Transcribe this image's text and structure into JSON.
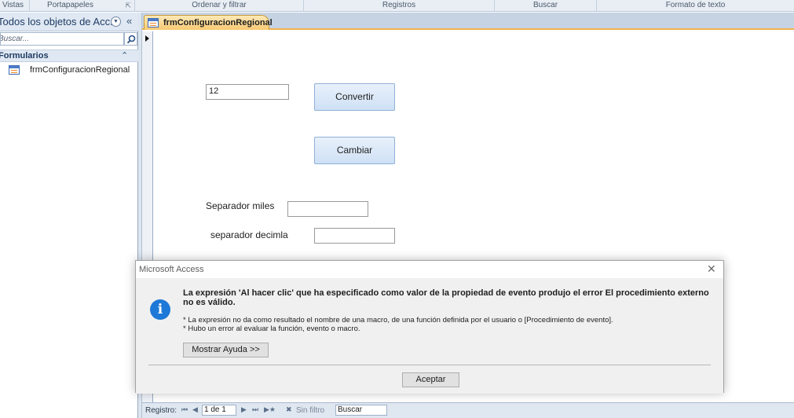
{
  "ribbon": {
    "groups": [
      "Vistas",
      "Portapapeles",
      "Ordenar y filtrar",
      "Registros",
      "Buscar",
      "Formato de texto"
    ]
  },
  "nav_pane": {
    "title": "Todos los objetos de Acc...",
    "search_placeholder": "Buscar...",
    "group_label": "Formularios",
    "items": [
      {
        "label": "frmConfiguracionRegional"
      }
    ]
  },
  "document_tab": {
    "label": "frmConfiguracionRegional"
  },
  "form": {
    "number_input_value": "12",
    "convert_button": "Convertir",
    "change_button": "Cambiar",
    "thousands_label": "Separador miles",
    "thousands_value": "",
    "decimal_label": "separador decimla",
    "decimal_value": ""
  },
  "status_bar": {
    "record_label": "Registro:",
    "record_position": "1 de 1",
    "filter_label": "Sin filtro",
    "search_label": "Buscar"
  },
  "dialog": {
    "title": "Microsoft Access",
    "message": "La expresión 'Al hacer clic' que ha especificado como valor de la propiedad de evento produjo el error El procedimiento externo no es válido.",
    "detail_1": "* La expresión no da como resultado el nombre de una macro, de una función definida por el usuario o [Procedimiento de evento].",
    "detail_2": "* Hubo un error al evaluar la función, evento o macro.",
    "help_button": "Mostrar Ayuda >>",
    "ok_button": "Aceptar"
  },
  "colors": {
    "accent_tab": "#f8c972",
    "info_icon": "#1e78d7",
    "button_fill": "#cfe0f5"
  }
}
